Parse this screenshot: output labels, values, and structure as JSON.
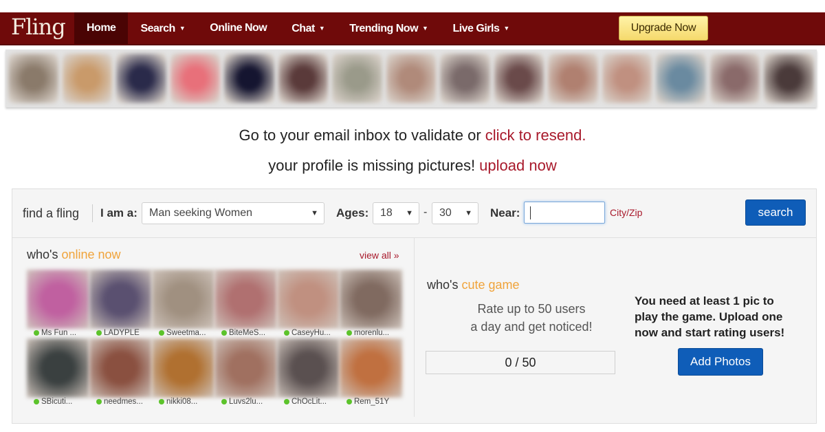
{
  "header": {
    "logo": "Fling",
    "nav": [
      {
        "label": "Home",
        "dropdown": false,
        "active": true
      },
      {
        "label": "Search",
        "dropdown": true,
        "active": false
      },
      {
        "label": "Online Now",
        "dropdown": false,
        "active": false
      },
      {
        "label": "Chat",
        "dropdown": true,
        "active": false
      },
      {
        "label": "Trending Now",
        "dropdown": true,
        "active": false
      },
      {
        "label": "Live Girls",
        "dropdown": true,
        "active": false
      }
    ],
    "upgrade_label": "Upgrade Now",
    "caret": "▼"
  },
  "strip_colors": [
    "#8a7a6a",
    "#c99a6a",
    "#2a2a4a",
    "#e8707a",
    "#151530",
    "#5a3a3a",
    "#9a9a8a",
    "#b08a7a",
    "#7a6a6a",
    "#6a4a4a",
    "#b08070",
    "#c09080",
    "#6a8aa0",
    "#8a6a6a",
    "#4a3a3a"
  ],
  "notices": {
    "email_text": "Go to your email inbox to validate or ",
    "email_link": "click to resend.",
    "pictures_text": "your profile is missing pictures! ",
    "pictures_link": "upload now"
  },
  "search": {
    "title": "find a fling",
    "iam_label": "I am a:",
    "iam_value": "Man seeking Women",
    "ages_label": "Ages:",
    "age_min": "18",
    "age_sep": "-",
    "age_max": "30",
    "near_label": "Near:",
    "near_value": "",
    "near_hint": "City/Zip",
    "button": "search"
  },
  "online": {
    "title_prefix": "who's ",
    "title_accent": "online now",
    "view_all": "view all »",
    "users": [
      {
        "name": "Ms Fun ...",
        "color": "#c060a0"
      },
      {
        "name": "LADYPLE",
        "color": "#5a5070"
      },
      {
        "name": "Sweetma...",
        "color": "#a09080"
      },
      {
        "name": "BiteMeS...",
        "color": "#b07070"
      },
      {
        "name": "CaseyHu...",
        "color": "#c09080"
      },
      {
        "name": "morenlu...",
        "color": "#806a60"
      },
      {
        "name": "SBicuti...",
        "color": "#3a4040"
      },
      {
        "name": "needmes...",
        "color": "#8a5040"
      },
      {
        "name": "nikki08...",
        "color": "#b07030"
      },
      {
        "name": "Luvs2lu...",
        "color": "#a07060"
      },
      {
        "name": "ChOcLit...",
        "color": "#5a5050"
      },
      {
        "name": "Rem_51Y",
        "color": "#c07040"
      }
    ]
  },
  "cute_game": {
    "title_prefix": "who's ",
    "title_accent": "cute game",
    "rate_line1": "Rate up to 50 users",
    "rate_line2": "a day and get noticed!",
    "counter": "0 / 50",
    "need_pic": "You need at least 1 pic to play the game. Upload one now and start rating users!",
    "button": "Add Photos"
  }
}
